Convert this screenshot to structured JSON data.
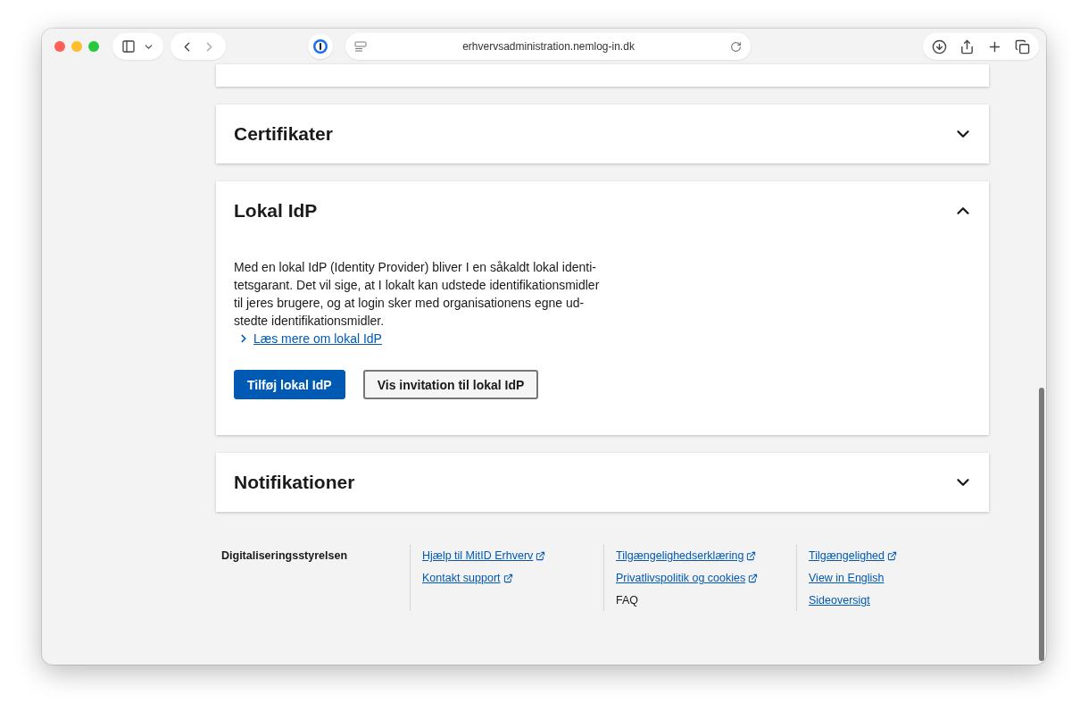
{
  "browser": {
    "url": "erhvervsadministration.nemlog-in.dk"
  },
  "sections": [
    {
      "title": "Certifikater",
      "expanded": false
    },
    {
      "title": "Lokal IdP",
      "expanded": true,
      "body_lines": [
        "Med en lokal IdP (Identity Provider) bliver I en såkaldt lokal identi-",
        "tetsgarant. Det vil sige, at I lokalt kan udstede identifikationsmidler",
        "til jeres brugere, og at login sker med organisationens egne ud-",
        "stedte identifikationsmidler."
      ],
      "link": "Læs mere om lokal IdP",
      "buttons": [
        {
          "label": "Tilføj lokal IdP",
          "kind": "primary"
        },
        {
          "label": "Vis invitation til lokal IdP",
          "kind": "secondary"
        }
      ]
    },
    {
      "title": "Notifikationer",
      "expanded": false
    }
  ],
  "footer": {
    "organization": "Digitaliseringsstyrelsen",
    "columns": [
      [
        {
          "label": "Hjælp til MitID Erhverv",
          "kind": "external"
        },
        {
          "label": "Kontakt support",
          "kind": "external"
        }
      ],
      [
        {
          "label": "Tilgængelighedserklæring",
          "kind": "external"
        },
        {
          "label": "Privatlivspolitik og cookies",
          "kind": "external"
        },
        {
          "label": "FAQ",
          "kind": "text"
        }
      ],
      [
        {
          "label": "Tilgængelighed",
          "kind": "external"
        },
        {
          "label": "View in English",
          "kind": "link"
        },
        {
          "label": "Sideoversigt",
          "kind": "link"
        }
      ]
    ]
  }
}
